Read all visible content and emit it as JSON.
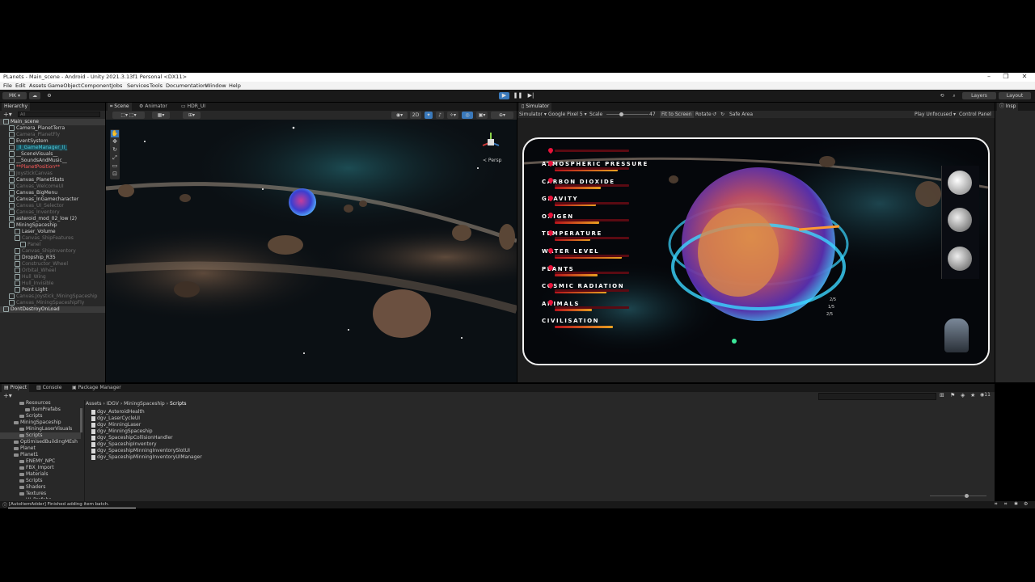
{
  "window": {
    "title": "PLanets - Main_scene - Android - Unity 2021.3.13f1 Personal <DX11>",
    "controls": [
      "–",
      "❐",
      "✕"
    ]
  },
  "menu": [
    "File",
    "Edit",
    "Assets",
    "GameObject",
    "Component",
    "Jobs",
    "Services",
    "Tools",
    "Documentation",
    "Window",
    "Help"
  ],
  "toolbar": {
    "account": "MK ▾",
    "layers": "Layers",
    "layout": "Layout"
  },
  "hierarchy": {
    "tab": "Hierarchy",
    "search_placeholder": "All",
    "items": [
      {
        "label": "Main_scene",
        "depth": 0,
        "style": "scene"
      },
      {
        "label": "Camera_PlanetTerra",
        "depth": 1,
        "style": "normal"
      },
      {
        "label": "Camera_PlanetFly",
        "depth": 1,
        "style": "dim"
      },
      {
        "label": "EventSystem",
        "depth": 1,
        "style": "normal"
      },
      {
        "label": "_II_GameManager_II_",
        "depth": 1,
        "style": "cyan"
      },
      {
        "label": "__SceneVisuals__",
        "depth": 1,
        "style": "normal"
      },
      {
        "label": "__SoundsAndMusic__",
        "depth": 1,
        "style": "normal"
      },
      {
        "label": "**PlanetPosition**",
        "depth": 1,
        "style": "red"
      },
      {
        "label": "JoystickCanvas",
        "depth": 1,
        "style": "dim"
      },
      {
        "label": "Canvas_PlanetStats",
        "depth": 1,
        "style": "normal"
      },
      {
        "label": "Canvas_WelcomeUI",
        "depth": 1,
        "style": "dim"
      },
      {
        "label": "Canvas_BigMenu",
        "depth": 1,
        "style": "normal"
      },
      {
        "label": "Canvas_InGamecharacter",
        "depth": 1,
        "style": "normal"
      },
      {
        "label": "Canvas_UI_Selector",
        "depth": 1,
        "style": "dim"
      },
      {
        "label": "Canvas_Inventory",
        "depth": 1,
        "style": "dim"
      },
      {
        "label": "asteroid_mod_02_low (2)",
        "depth": 1,
        "style": "normal"
      },
      {
        "label": "MiningSpaceship",
        "depth": 1,
        "style": "normal"
      },
      {
        "label": "Laser_Volume",
        "depth": 2,
        "style": "normal"
      },
      {
        "label": "Canvas_ShipFeatures",
        "depth": 2,
        "style": "dim"
      },
      {
        "label": "Panel",
        "depth": 3,
        "style": "dim"
      },
      {
        "label": "Canvas_ShipInventory",
        "depth": 2,
        "style": "dim"
      },
      {
        "label": "Dropship_R35",
        "depth": 2,
        "style": "normal"
      },
      {
        "label": "Constructor_Wheel",
        "depth": 2,
        "style": "dim"
      },
      {
        "label": "Orbital_Wheel",
        "depth": 2,
        "style": "dim"
      },
      {
        "label": "Hull_Wing",
        "depth": 2,
        "style": "dim"
      },
      {
        "label": "Hull_Invisible",
        "depth": 2,
        "style": "dim"
      },
      {
        "label": "Point Light",
        "depth": 2,
        "style": "normal"
      },
      {
        "label": "Canvas.Joystick_MiningSpaceship",
        "depth": 1,
        "style": "dim"
      },
      {
        "label": "Canvas_MiningSpaceshipFly",
        "depth": 1,
        "style": "dim"
      },
      {
        "label": "DontDestroyOnLoad",
        "depth": 0,
        "style": "scene"
      }
    ]
  },
  "scene_tabs": [
    "Scene",
    "Animator",
    "HDR_UI"
  ],
  "scene_view": {
    "projection": "< Persp"
  },
  "simulator": {
    "tab": "Simulator",
    "controls": {
      "mode": "Simulator ▾",
      "device": "Google Pixel 5 ▾",
      "scale_label": "Scale",
      "scale_value": "47",
      "fit": "Fit to Screen",
      "rotate": "Rotate",
      "safe_area": "Safe Area",
      "play_mode": "Play Unfocused ▾",
      "control_panel": "Control Panel"
    },
    "stats": [
      {
        "name": "ATMOSPHERIC PRESSURE",
        "level": 0.85
      },
      {
        "name": "CARBON DIOXIDE",
        "level": 0.62
      },
      {
        "name": "GRAVITY",
        "level": 0.55
      },
      {
        "name": "OXIGEN",
        "level": 0.6
      },
      {
        "name": "TEMPERATURE",
        "level": 0.48
      },
      {
        "name": "WATER LEVEL",
        "level": 0.9
      },
      {
        "name": "PLANTS",
        "level": 0.58
      },
      {
        "name": "COSMIC RADIATION",
        "level": 0.7
      },
      {
        "name": "ANIMALS",
        "level": 0.5
      },
      {
        "name": "CIVILISATION",
        "level": 0.78
      }
    ],
    "ring_labels": [
      "2/5",
      "1/5",
      "2/5"
    ]
  },
  "project": {
    "tabs": [
      "Project",
      "Console",
      "Package Manager"
    ],
    "breadcrumb": [
      "Assets",
      "IDGV",
      "MiningSpaceship",
      "Scripts"
    ],
    "tree": [
      {
        "label": "Resources",
        "depth": 2
      },
      {
        "label": "ItemPrefabs",
        "depth": 3
      },
      {
        "label": "Scripts",
        "depth": 2
      },
      {
        "label": "MiningSpaceship",
        "depth": 1
      },
      {
        "label": "MiningLaserVisuals",
        "depth": 2
      },
      {
        "label": "Scripts",
        "depth": 2,
        "selected": true
      },
      {
        "label": "OptimisedBuildingMEsh",
        "depth": 1
      },
      {
        "label": "Planet",
        "depth": 1
      },
      {
        "label": "Planet1",
        "depth": 1
      },
      {
        "label": "ENEMY_NPC",
        "depth": 2
      },
      {
        "label": "FBX_Import",
        "depth": 2
      },
      {
        "label": "Materials",
        "depth": 2
      },
      {
        "label": "Scripts",
        "depth": 2
      },
      {
        "label": "Shaders",
        "depth": 2
      },
      {
        "label": "Textures",
        "depth": 2
      },
      {
        "label": "UI_Prefabs",
        "depth": 2
      },
      {
        "label": "Presets",
        "depth": 1
      }
    ],
    "files": [
      "dgv_AsteroidHealth",
      "dgv_LaserCycleUI",
      "dgv_MinningLaser",
      "dgv_MinningSpaceship",
      "dgv_SpaceshipCollisionHandler",
      "dgv_SpaceshipInventory",
      "dgv_SpaceshipMinningInventorySlotUI",
      "dgv_SpaceshipMinningInventoryUIManager"
    ],
    "count": "11"
  },
  "status": {
    "message": "[AutoItemAdder] Finished adding item batch."
  },
  "colors": {
    "accent": "#3a79bb",
    "selection": "#2c5d87",
    "bg": "#282828",
    "dark": "#191919"
  }
}
